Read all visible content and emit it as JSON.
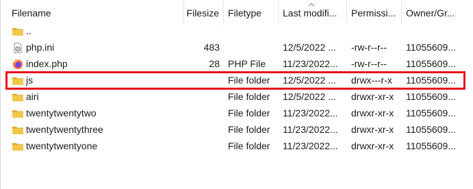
{
  "columns": {
    "filename": "Filename",
    "filesize": "Filesize",
    "filetype": "Filetype",
    "modified": "Last modifi...",
    "permissions": "Permissi...",
    "owner": "Owner/Gr..."
  },
  "sort": {
    "column": "modified",
    "direction": "ascending"
  },
  "files": [
    {
      "name": "..",
      "size": "",
      "type": "",
      "modified": "",
      "permissions": "",
      "owner": "",
      "icon": "folder-icon"
    },
    {
      "name": "php.ini",
      "size": "483",
      "type": "",
      "modified": "12/5/2022 ...",
      "permissions": "-rw-r--r--",
      "owner": "11055609...",
      "icon": "ini-file-icon"
    },
    {
      "name": "index.php",
      "size": "28",
      "type": "PHP File",
      "modified": "11/23/2022...",
      "permissions": "-rw-r--r--",
      "owner": "11055609...",
      "icon": "firefox-icon"
    },
    {
      "name": "js",
      "size": "",
      "type": "File folder",
      "modified": "12/5/2022 ...",
      "permissions": "drwx---r-x",
      "owner": "11055609...",
      "icon": "folder-icon",
      "highlighted": true
    },
    {
      "name": "airi",
      "size": "",
      "type": "File folder",
      "modified": "12/5/2022 ...",
      "permissions": "drwxr-xr-x",
      "owner": "11055609...",
      "icon": "folder-icon"
    },
    {
      "name": "twentytwentytwo",
      "size": "",
      "type": "File folder",
      "modified": "11/23/2022...",
      "permissions": "drwxr-xr-x",
      "owner": "11055609...",
      "icon": "folder-icon"
    },
    {
      "name": "twentytwentythree",
      "size": "",
      "type": "File folder",
      "modified": "11/23/2022...",
      "permissions": "drwxr-xr-x",
      "owner": "11055609...",
      "icon": "folder-icon"
    },
    {
      "name": "twentytwentyone",
      "size": "",
      "type": "File folder",
      "modified": "11/23/2022...",
      "permissions": "drwxr-xr-x",
      "owner": "11055609...",
      "icon": "folder-icon"
    }
  ],
  "colors": {
    "highlight": "#e8121a",
    "folder": "#f2c84b",
    "folder_dark": "#dcaa2e"
  }
}
